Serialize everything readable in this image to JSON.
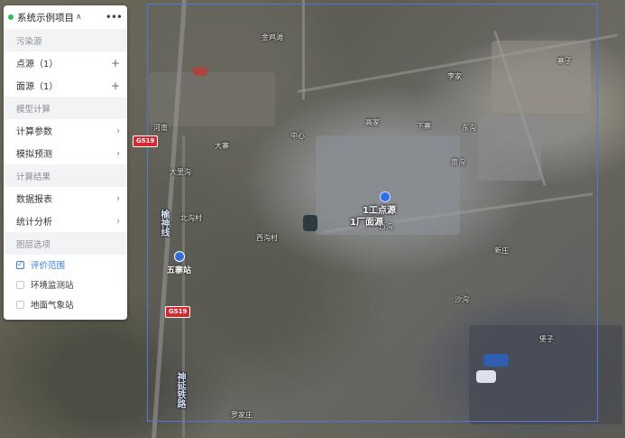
{
  "panel": {
    "project_title": "系统示例项目",
    "title_chevron": "∧",
    "more_icon": "•••",
    "sections": {
      "pollution": "污染源",
      "model": "模型计算",
      "results": "计算结果",
      "layers": "图层选项"
    },
    "pollution_items": [
      {
        "label": "点源（1）",
        "action": "+"
      },
      {
        "label": "面源（1）",
        "action": "+"
      }
    ],
    "model_items": [
      {
        "label": "计算参数",
        "action": "›"
      },
      {
        "label": "模拟预测",
        "action": "›"
      }
    ],
    "result_items": [
      {
        "label": "数据报表",
        "action": "›"
      },
      {
        "label": "统计分析",
        "action": "›"
      }
    ],
    "layer_items": [
      {
        "label": "评价范围",
        "checked": true,
        "check_glyph": "✓"
      },
      {
        "label": "环境监测站",
        "checked": false,
        "check_glyph": ""
      },
      {
        "label": "地面气象站",
        "checked": false,
        "check_glyph": ""
      }
    ]
  },
  "map": {
    "study_area_color": "#4f78d8",
    "highway_shield_1": "G519",
    "highway_shield_2": "G519",
    "station_name": "五寨站",
    "source_label": "1工点源",
    "source_label_2": "1厂面源",
    "vertical_label_1": "榆神线",
    "vertical_label_2": "神延铁路",
    "places": [
      "金鸡滩",
      "河南",
      "大寨",
      "中心",
      "大里沟",
      "北沟村",
      "西沟村",
      "下寨",
      "东沟",
      "李家",
      "南沟",
      "寨子",
      "新庄",
      "沙沟",
      "西沟",
      "罗家庄",
      "高家",
      "堡子"
    ]
  }
}
